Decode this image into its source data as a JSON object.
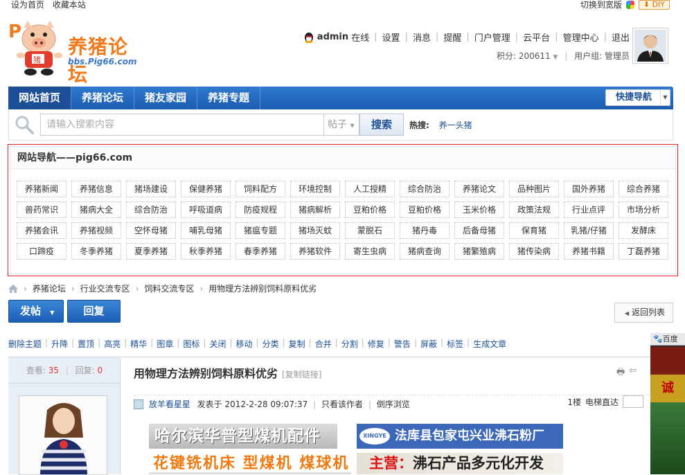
{
  "topbar": {
    "set_home": "设为首页",
    "bookmark": "收藏本站",
    "switch_wide": "切换到宽版",
    "diy": "DIY"
  },
  "logo": {
    "name": "养猪论坛",
    "url": "bbs.Pig66.com",
    "badge": "猪"
  },
  "user": {
    "name": "admin",
    "status": "在线",
    "links": [
      "设置",
      "消息",
      "提醒",
      "门户管理",
      "云平台",
      "管理中心",
      "退出"
    ],
    "points_label": "积分: 200611",
    "group_label": "用户组: 管理员"
  },
  "mainnav": {
    "items": [
      "网站首页",
      "养猪论坛",
      "猪友家园",
      "养猪专题"
    ],
    "quick": "快捷导航"
  },
  "search": {
    "placeholder": "请输入搜索内容",
    "type": "帖子",
    "button": "搜索",
    "hot_label": "热搜:",
    "hot_item": "养一头猪"
  },
  "sitenav": {
    "title": "网站导航——pig66.com",
    "rows": [
      [
        "养猪新闻",
        "养猪信息",
        "猪场建设",
        "保健养猪",
        "饲料配方",
        "环境控制",
        "人工授精",
        "综合防治",
        "养猪论文",
        "品种图片",
        "国外养猪",
        "综合养猪"
      ],
      [
        "兽药常识",
        "猪病大全",
        "综合防治",
        "呼吸道病",
        "防疫规程",
        "猪病解析",
        "豆粕价格",
        "豆粕价格",
        "玉米价格",
        "政策法规",
        "行业点评",
        "市场分析"
      ],
      [
        "养猪会讯",
        "养猪视频",
        "空怀母猪",
        "哺乳母猪",
        "猪瘟专题",
        "猪场灭蚊",
        "蒙脱石",
        "猪丹毒",
        "后备母猪",
        "保育猪",
        "乳猪/仔猪",
        "发酵床"
      ],
      [
        "口蹄疫",
        "冬季养猪",
        "夏季养猪",
        "秋季养猪",
        "春季养猪",
        "养猪软件",
        "寄生虫病",
        "猪病查询",
        "猪繁殖病",
        "猪传染病",
        "养猪书籍",
        "丁磊养猪"
      ]
    ]
  },
  "breadcrumb": [
    "养猪论坛",
    "行业交流专区",
    "饲料交流专区",
    "用物理方法辨别饲料原料优劣"
  ],
  "actions": {
    "post": "发帖",
    "reply": "回复",
    "back": "返回列表"
  },
  "modbar": [
    "删除主题",
    "升降",
    "置顶",
    "高亮",
    "精华",
    "图章",
    "图标",
    "关闭",
    "移动",
    "分类",
    "复制",
    "合并",
    "分割",
    "修复",
    "警告",
    "屏蔽",
    "标签",
    "生成文章"
  ],
  "thread": {
    "views_label": "查看:",
    "views": "35",
    "replies_label": "回复:",
    "replies": "0",
    "title": "用物理方法辨别饲料原料优劣",
    "copy_link": "[复制链接]",
    "author": "放羊看星星",
    "posted": "发表于  2012-2-28 09:07:37",
    "only_author": "只看该作者",
    "reverse": "倒序浏览",
    "floor": "1楼",
    "jump": "电梯直达"
  },
  "ads": {
    "a1": "哈尔滨华普型煤机配件",
    "a2": "法库县包家屯兴业沸石粉厂",
    "a2_logo": "XINGYE",
    "a3": "花键铣机床 型煤机 煤球机",
    "a4_prefix": "主营：",
    "a4": "沸石产品多元化开发",
    "float_head": "百度推",
    "float_text": "诚"
  }
}
